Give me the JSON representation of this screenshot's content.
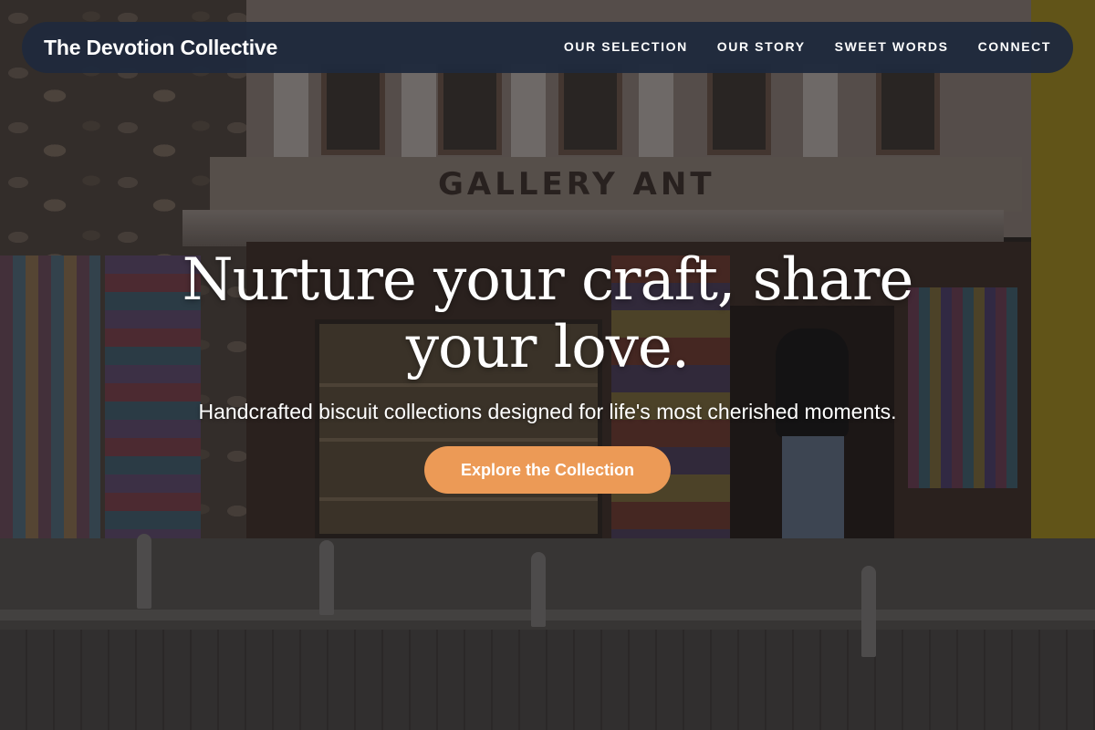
{
  "site": {
    "brand": "The Devotion Collective"
  },
  "nav": {
    "items": [
      {
        "label": "OUR SELECTION"
      },
      {
        "label": "OUR STORY"
      },
      {
        "label": "SWEET WORDS"
      },
      {
        "label": "CONNECT"
      }
    ]
  },
  "hero": {
    "title": "Nurture your craft, share your love.",
    "subtitle": "Handcrafted biscuit collections designed for life's most cherished moments.",
    "cta_label": "Explore the Collection"
  },
  "background": {
    "sign_text": "GALLERY ANT",
    "colors": {
      "navbar": "#1f2a3c",
      "cta": "#ec9a56",
      "text": "#ffffff"
    }
  }
}
